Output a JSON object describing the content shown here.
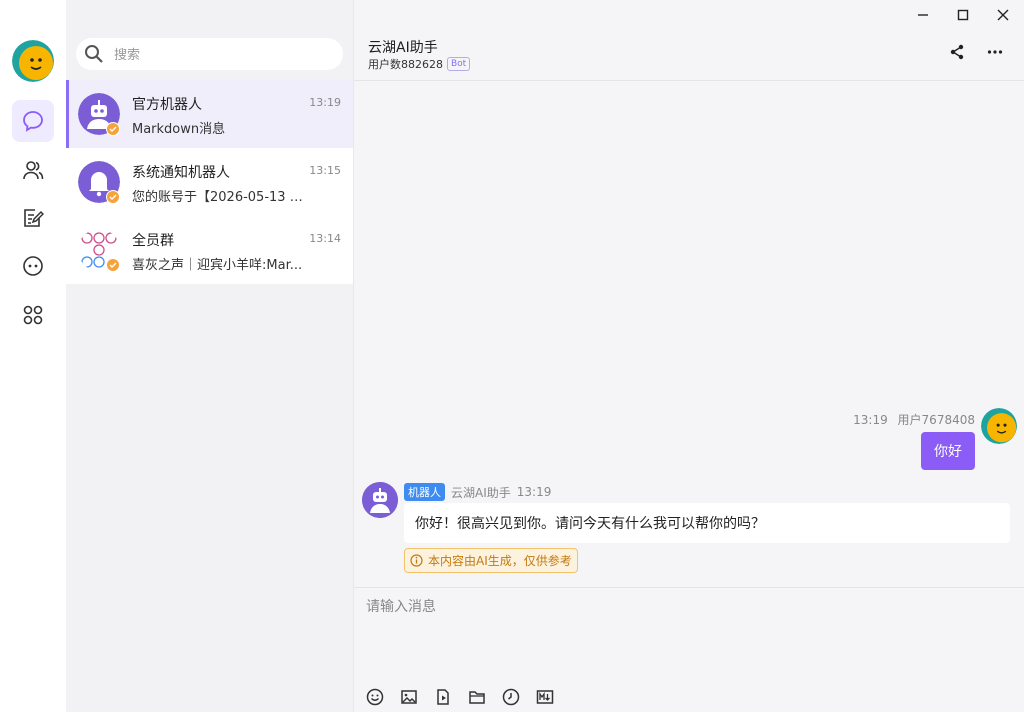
{
  "search": {
    "placeholder": "搜索"
  },
  "conversations": [
    {
      "name": "官方机器人",
      "time": "13:19",
      "preview": "Markdown消息",
      "avatar_icon": "robot-icon"
    },
    {
      "name": "系统通知机器人",
      "time": "13:15",
      "preview": "您的账号于【2026-05-13 1...",
      "avatar_icon": "bell-icon"
    },
    {
      "name": "全员群",
      "time": "13:14",
      "preview": "喜灰之声｜迎宾小羊咩:Mar...",
      "avatar_icon": "group-icon"
    }
  ],
  "chat": {
    "title": "云湖AI助手",
    "subtitle": "用户数882628",
    "bot_tag": "Bot",
    "input_placeholder": "请输入消息",
    "messages": {
      "me": {
        "time": "13:19",
        "sender": "用户7678408",
        "text": "你好"
      },
      "bot": {
        "tag": "机器人",
        "sender": "云湖AI助手",
        "time": "13:19",
        "text": "你好！很高兴见到你。请问今天有什么我可以帮你的吗？",
        "notice": "本内容由AI生成，仅供参考"
      }
    }
  },
  "colors": {
    "accent": "#8b5cf6",
    "active_bg": "#f1eefc",
    "robot_tag": "#3f8cf0",
    "notice": "#c27a0e",
    "badge": "#f3a43c"
  }
}
